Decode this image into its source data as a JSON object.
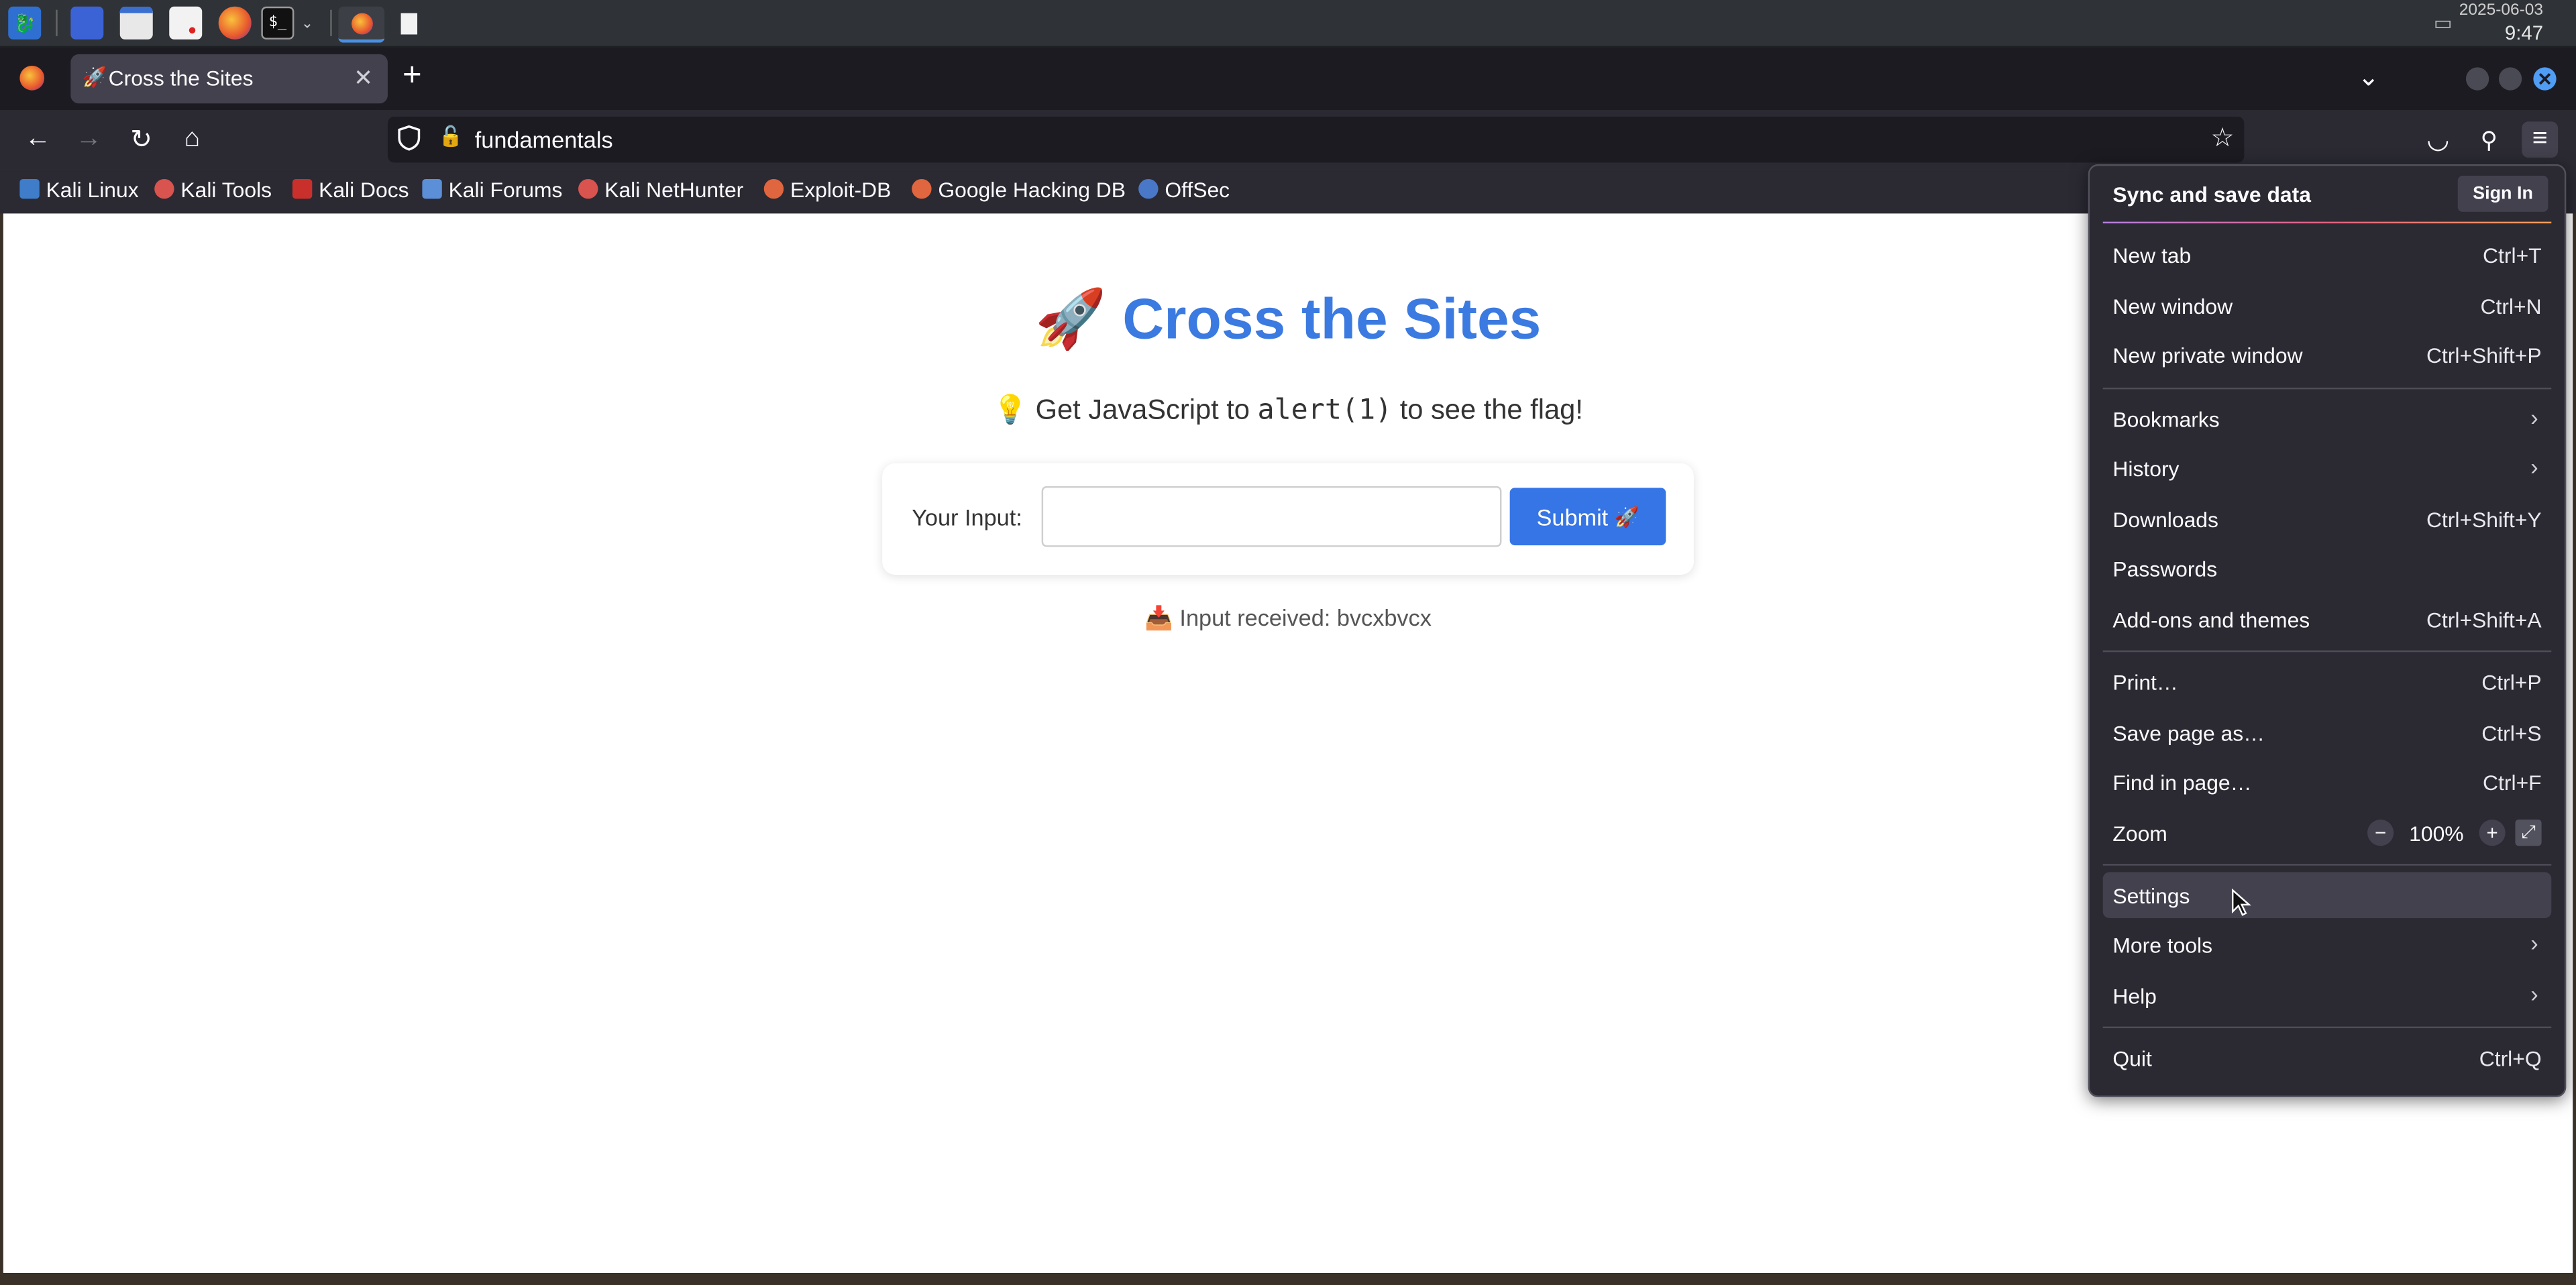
{
  "taskbar": {
    "date": "2025-06-03",
    "time": "9:47",
    "icons": [
      "kali-dragon-icon",
      "workspace-icon",
      "file-manager-icon",
      "text-editor-icon",
      "firefox-icon",
      "terminal-icon",
      "chevron-down-icon",
      "firefox-window-icon",
      "document-window-icon"
    ]
  },
  "browser": {
    "tab_title": "Cross the Sites",
    "url": "fundamentals",
    "bookmarks": [
      "Kali Linux",
      "Kali Tools",
      "Kali Docs",
      "Kali Forums",
      "Kali NetHunter",
      "Exploit-DB",
      "Google Hacking DB",
      "OffSec"
    ]
  },
  "page": {
    "title_icon": "🚀",
    "title": "Cross the Sites",
    "subtitle_icon": "💡",
    "subtitle_pre": "Get JavaScript to",
    "subtitle_code": "alert(1)",
    "subtitle_post": "to see the flag!",
    "input_label": "Your Input:",
    "input_value": "",
    "submit_label": "Submit",
    "submit_icon": "🚀",
    "received_icon": "📥",
    "received_text": "Input received: bvcxbvcx"
  },
  "menu": {
    "header": "Sync and save data",
    "sign_in": "Sign In",
    "new_tab": "New tab",
    "new_tab_key": "Ctrl+T",
    "new_window": "New window",
    "new_window_key": "Ctrl+N",
    "new_private": "New private window",
    "new_private_key": "Ctrl+Shift+P",
    "bookmarks": "Bookmarks",
    "history": "History",
    "downloads": "Downloads",
    "downloads_key": "Ctrl+Shift+Y",
    "passwords": "Passwords",
    "addons": "Add-ons and themes",
    "addons_key": "Ctrl+Shift+A",
    "print": "Print…",
    "print_key": "Ctrl+P",
    "save_page": "Save page as…",
    "save_page_key": "Ctrl+S",
    "find": "Find in page…",
    "find_key": "Ctrl+F",
    "zoom": "Zoom",
    "zoom_level": "100%",
    "settings": "Settings",
    "more_tools": "More tools",
    "help": "Help",
    "quit": "Quit",
    "quit_key": "Ctrl+Q"
  }
}
